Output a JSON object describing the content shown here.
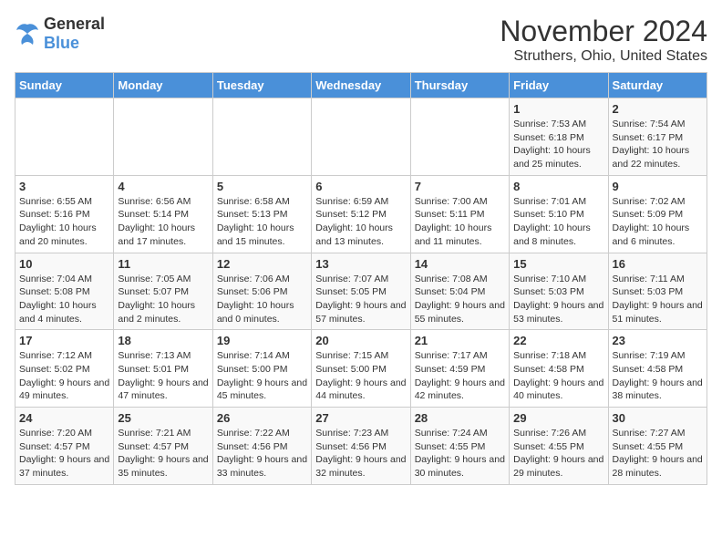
{
  "logo": {
    "general": "General",
    "blue": "Blue"
  },
  "header": {
    "month": "November 2024",
    "location": "Struthers, Ohio, United States"
  },
  "weekdays": [
    "Sunday",
    "Monday",
    "Tuesday",
    "Wednesday",
    "Thursday",
    "Friday",
    "Saturday"
  ],
  "weeks": [
    [
      {
        "day": "",
        "info": ""
      },
      {
        "day": "",
        "info": ""
      },
      {
        "day": "",
        "info": ""
      },
      {
        "day": "",
        "info": ""
      },
      {
        "day": "",
        "info": ""
      },
      {
        "day": "1",
        "info": "Sunrise: 7:53 AM\nSunset: 6:18 PM\nDaylight: 10 hours and 25 minutes."
      },
      {
        "day": "2",
        "info": "Sunrise: 7:54 AM\nSunset: 6:17 PM\nDaylight: 10 hours and 22 minutes."
      }
    ],
    [
      {
        "day": "3",
        "info": "Sunrise: 6:55 AM\nSunset: 5:16 PM\nDaylight: 10 hours and 20 minutes."
      },
      {
        "day": "4",
        "info": "Sunrise: 6:56 AM\nSunset: 5:14 PM\nDaylight: 10 hours and 17 minutes."
      },
      {
        "day": "5",
        "info": "Sunrise: 6:58 AM\nSunset: 5:13 PM\nDaylight: 10 hours and 15 minutes."
      },
      {
        "day": "6",
        "info": "Sunrise: 6:59 AM\nSunset: 5:12 PM\nDaylight: 10 hours and 13 minutes."
      },
      {
        "day": "7",
        "info": "Sunrise: 7:00 AM\nSunset: 5:11 PM\nDaylight: 10 hours and 11 minutes."
      },
      {
        "day": "8",
        "info": "Sunrise: 7:01 AM\nSunset: 5:10 PM\nDaylight: 10 hours and 8 minutes."
      },
      {
        "day": "9",
        "info": "Sunrise: 7:02 AM\nSunset: 5:09 PM\nDaylight: 10 hours and 6 minutes."
      }
    ],
    [
      {
        "day": "10",
        "info": "Sunrise: 7:04 AM\nSunset: 5:08 PM\nDaylight: 10 hours and 4 minutes."
      },
      {
        "day": "11",
        "info": "Sunrise: 7:05 AM\nSunset: 5:07 PM\nDaylight: 10 hours and 2 minutes."
      },
      {
        "day": "12",
        "info": "Sunrise: 7:06 AM\nSunset: 5:06 PM\nDaylight: 10 hours and 0 minutes."
      },
      {
        "day": "13",
        "info": "Sunrise: 7:07 AM\nSunset: 5:05 PM\nDaylight: 9 hours and 57 minutes."
      },
      {
        "day": "14",
        "info": "Sunrise: 7:08 AM\nSunset: 5:04 PM\nDaylight: 9 hours and 55 minutes."
      },
      {
        "day": "15",
        "info": "Sunrise: 7:10 AM\nSunset: 5:03 PM\nDaylight: 9 hours and 53 minutes."
      },
      {
        "day": "16",
        "info": "Sunrise: 7:11 AM\nSunset: 5:03 PM\nDaylight: 9 hours and 51 minutes."
      }
    ],
    [
      {
        "day": "17",
        "info": "Sunrise: 7:12 AM\nSunset: 5:02 PM\nDaylight: 9 hours and 49 minutes."
      },
      {
        "day": "18",
        "info": "Sunrise: 7:13 AM\nSunset: 5:01 PM\nDaylight: 9 hours and 47 minutes."
      },
      {
        "day": "19",
        "info": "Sunrise: 7:14 AM\nSunset: 5:00 PM\nDaylight: 9 hours and 45 minutes."
      },
      {
        "day": "20",
        "info": "Sunrise: 7:15 AM\nSunset: 5:00 PM\nDaylight: 9 hours and 44 minutes."
      },
      {
        "day": "21",
        "info": "Sunrise: 7:17 AM\nSunset: 4:59 PM\nDaylight: 9 hours and 42 minutes."
      },
      {
        "day": "22",
        "info": "Sunrise: 7:18 AM\nSunset: 4:58 PM\nDaylight: 9 hours and 40 minutes."
      },
      {
        "day": "23",
        "info": "Sunrise: 7:19 AM\nSunset: 4:58 PM\nDaylight: 9 hours and 38 minutes."
      }
    ],
    [
      {
        "day": "24",
        "info": "Sunrise: 7:20 AM\nSunset: 4:57 PM\nDaylight: 9 hours and 37 minutes."
      },
      {
        "day": "25",
        "info": "Sunrise: 7:21 AM\nSunset: 4:57 PM\nDaylight: 9 hours and 35 minutes."
      },
      {
        "day": "26",
        "info": "Sunrise: 7:22 AM\nSunset: 4:56 PM\nDaylight: 9 hours and 33 minutes."
      },
      {
        "day": "27",
        "info": "Sunrise: 7:23 AM\nSunset: 4:56 PM\nDaylight: 9 hours and 32 minutes."
      },
      {
        "day": "28",
        "info": "Sunrise: 7:24 AM\nSunset: 4:55 PM\nDaylight: 9 hours and 30 minutes."
      },
      {
        "day": "29",
        "info": "Sunrise: 7:26 AM\nSunset: 4:55 PM\nDaylight: 9 hours and 29 minutes."
      },
      {
        "day": "30",
        "info": "Sunrise: 7:27 AM\nSunset: 4:55 PM\nDaylight: 9 hours and 28 minutes."
      }
    ]
  ]
}
